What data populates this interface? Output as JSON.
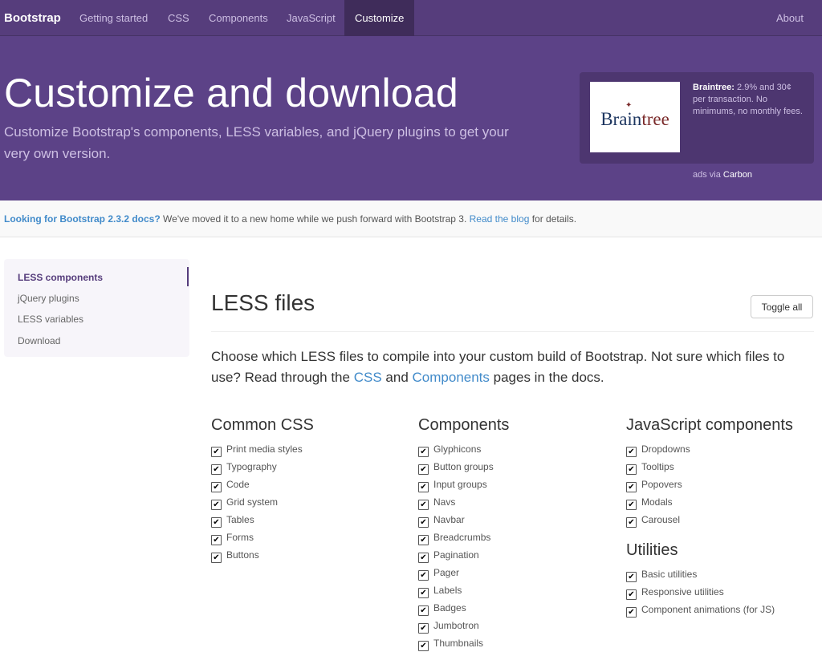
{
  "navbar": {
    "brand": "Bootstrap",
    "items": [
      {
        "label": "Getting started"
      },
      {
        "label": "CSS"
      },
      {
        "label": "Components"
      },
      {
        "label": "JavaScript"
      },
      {
        "label": "Customize",
        "active": true
      }
    ],
    "right": "About"
  },
  "jumbotron": {
    "title": "Customize and download",
    "lead": "Customize Bootstrap's components, LESS variables, and jQuery plugins to get your very own version."
  },
  "ad": {
    "logo_text_a": "Brain",
    "logo_text_b": "tree",
    "brand": "Braintree:",
    "text": "2.9% and 30¢ per transaction. No minimums, no monthly fees.",
    "via_prefix": "ads via",
    "via_name": "Carbon"
  },
  "notice": {
    "strong": "Looking for Bootstrap 2.3.2 docs?",
    "text": "We've moved it to a new home while we push forward with Bootstrap 3.",
    "link": "Read the blog",
    "suffix": "for details."
  },
  "sidebar": {
    "items": [
      {
        "label": "LESS components",
        "active": true
      },
      {
        "label": "jQuery plugins"
      },
      {
        "label": "LESS variables"
      },
      {
        "label": "Download"
      }
    ]
  },
  "main": {
    "title": "LESS files",
    "toggle_label": "Toggle all",
    "intro_a": "Choose which LESS files to compile into your custom build of Bootstrap. Not sure which files to use? Read through the",
    "intro_link1": "CSS",
    "intro_and": "and",
    "intro_link2": "Components",
    "intro_b": "pages in the docs."
  },
  "columns": {
    "common_css": {
      "heading": "Common CSS",
      "items": [
        "Print media styles",
        "Typography",
        "Code",
        "Grid system",
        "Tables",
        "Forms",
        "Buttons"
      ]
    },
    "components": {
      "heading": "Components",
      "items": [
        "Glyphicons",
        "Button groups",
        "Input groups",
        "Navs",
        "Navbar",
        "Breadcrumbs",
        "Pagination",
        "Pager",
        "Labels",
        "Badges",
        "Jumbotron",
        "Thumbnails"
      ]
    },
    "js_components": {
      "heading": "JavaScript components",
      "items": [
        "Dropdowns",
        "Tooltips",
        "Popovers",
        "Modals",
        "Carousel"
      ]
    },
    "utilities": {
      "heading": "Utilities",
      "items": [
        "Basic utilities",
        "Responsive utilities",
        "Component animations (for JS)"
      ]
    }
  },
  "checkbox_state": "checked",
  "colors": {
    "brand_purple": "#563d7c",
    "jumbotron_purple": "#5c4287",
    "link_blue": "#428bca"
  }
}
